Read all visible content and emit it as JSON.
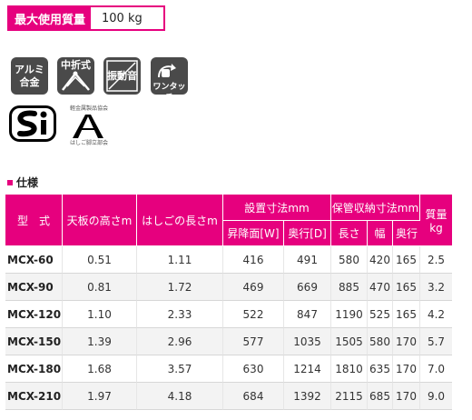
{
  "max_load": {
    "label": "最大使用質量",
    "value": "100 kg"
  },
  "icons": [
    {
      "name": "aluminum-alloy-icon",
      "line1": "アルミ",
      "line2": "合金"
    },
    {
      "name": "folding-icon",
      "line1": "中折式"
    },
    {
      "name": "vibration-noise-icon",
      "line1": "振動音"
    },
    {
      "name": "one-touch-icon",
      "line1": "ワンタッチ"
    }
  ],
  "certification": {
    "si_mark": "Si",
    "ladder_top": "軽金属製品協会",
    "ladder_bottom": "はしご脚立部会"
  },
  "section_title": "仕様",
  "table": {
    "headers": {
      "model": "型　式",
      "top_height": "天板の高さm",
      "ladder_length": "はしごの長さm",
      "install_group": "設置寸法mm",
      "storage_group": "保管収納寸法mm",
      "weight": "質量kg",
      "install_w": "昇降面[W]",
      "install_d": "奥行[D]",
      "storage_len": "長さ",
      "storage_width": "幅",
      "storage_depth": "奥行"
    },
    "rows": [
      [
        "MCX-60",
        "0.51",
        "1.11",
        "416",
        "491",
        "580",
        "420",
        "165",
        "2.5"
      ],
      [
        "MCX-90",
        "0.81",
        "1.72",
        "469",
        "669",
        "885",
        "470",
        "165",
        "3.2"
      ],
      [
        "MCX-120",
        "1.10",
        "2.33",
        "522",
        "847",
        "1190",
        "525",
        "165",
        "4.2"
      ],
      [
        "MCX-150",
        "1.39",
        "2.96",
        "577",
        "1035",
        "1505",
        "580",
        "170",
        "5.7"
      ],
      [
        "MCX-180",
        "1.68",
        "3.57",
        "630",
        "1214",
        "1810",
        "635",
        "170",
        "7.0"
      ],
      [
        "MCX-210",
        "1.97",
        "4.18",
        "684",
        "1392",
        "2115",
        "685",
        "170",
        "9.0"
      ]
    ]
  },
  "colors": {
    "accent": "#e6007e",
    "icon_bg": "#4a4a4a"
  }
}
